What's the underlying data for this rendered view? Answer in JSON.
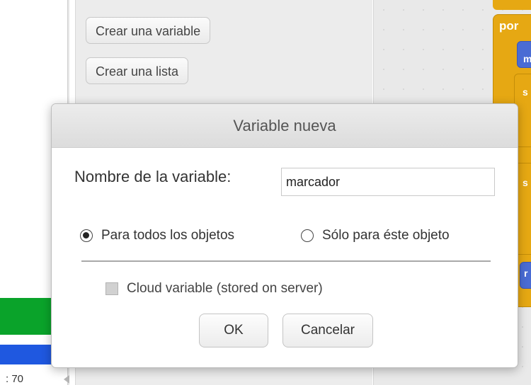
{
  "palette": {
    "make_variable_label": "Crear una variable",
    "make_list_label": "Crear una lista"
  },
  "scripts": {
    "forever_block_label": "por",
    "blue_block_label": "m",
    "inner_block_1_label": "s",
    "inner_block_2_label": "s",
    "inner_block_3_label": "r"
  },
  "stage": {
    "readout": ": 70"
  },
  "dialog": {
    "title": "Variable nueva",
    "name_label": "Nombre de la variable:",
    "name_value": "marcador",
    "radio_all_label": "Para todos los objetos",
    "radio_all_checked": true,
    "radio_this_label": "Sólo para éste objeto",
    "radio_this_checked": false,
    "cloud_label": "Cloud variable (stored on server)",
    "cloud_checked": false,
    "ok_label": "OK",
    "cancel_label": "Cancelar"
  },
  "colors": {
    "control_block": "#e6a813",
    "motion_block": "#4a6cd4",
    "green_bar": "#0aa32a",
    "blue_bar": "#1f58e0"
  }
}
